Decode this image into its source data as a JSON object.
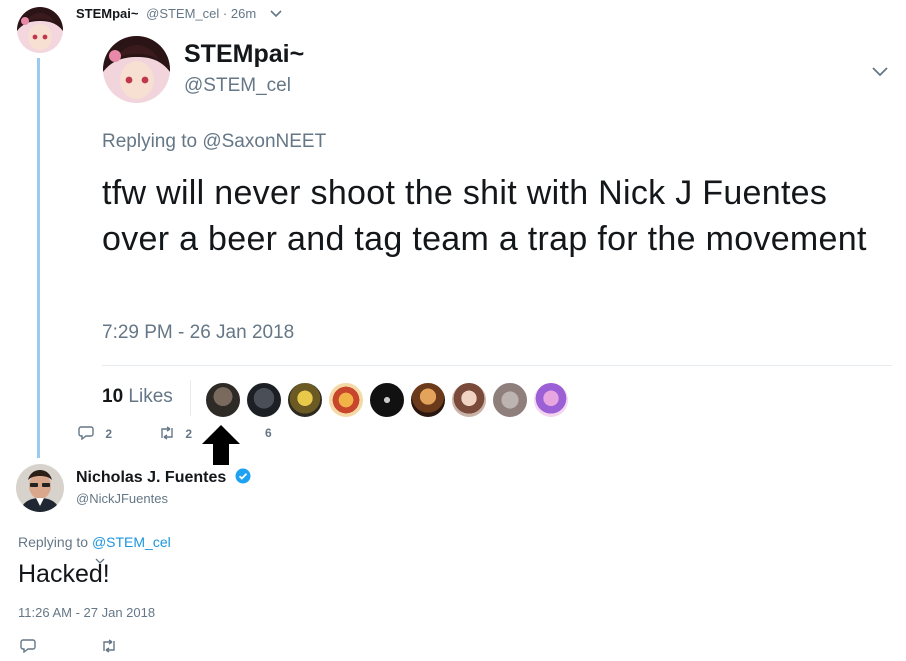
{
  "top_tweet": {
    "display_name": "STEMpai~",
    "handle": "@STEM_cel",
    "separator": "·",
    "time_ago": "26m"
  },
  "expanded_tweet": {
    "display_name": "STEMpai~",
    "handle": "@STEM_cel",
    "replying_prefix": "Replying to",
    "replying_to": "@SaxonNEET",
    "text": "tfw will never shoot the shit with Nick J Fuentes over a beer and tag team a trap for the movement",
    "timestamp": "7:29 PM - 26 Jan 2018",
    "likes_count": "10",
    "likes_label": "Likes",
    "reply_count": "2",
    "retweet_count": "2",
    "like_count_action": "6"
  },
  "reply_tweet": {
    "display_name": "Nicholas J. Fuentes",
    "handle": "@NickJFuentes",
    "replying_prefix": "Replying to",
    "replying_to": "@STEM_cel",
    "text": "Hacked!",
    "timestamp": "11:26 AM - 27 Jan 2018"
  },
  "colors": {
    "thread_line": "#9ccbf0",
    "link": "#1b95e0",
    "muted": "#657786",
    "verified": "#1da1f2"
  },
  "icons": [
    "chevron-down-icon",
    "reply-icon",
    "retweet-icon",
    "verified-badge-icon",
    "arrow-up-icon"
  ]
}
